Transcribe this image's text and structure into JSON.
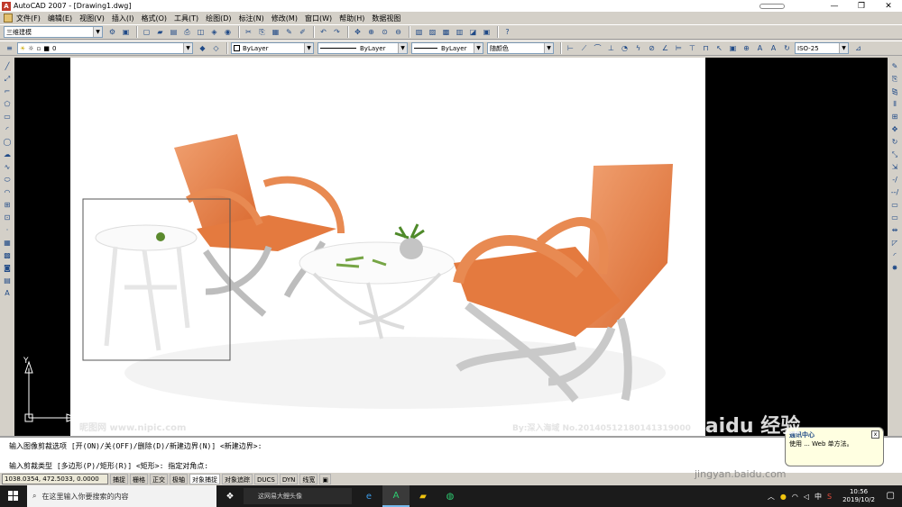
{
  "window": {
    "title": "AutoCAD 2007 - [Drawing1.dwg]",
    "app_icon": "A",
    "minimize": "—",
    "maximize": "❐",
    "close": "✕"
  },
  "menu": [
    "文件(F)",
    "编辑(E)",
    "视图(V)",
    "插入(I)",
    "格式(O)",
    "工具(T)",
    "绘图(D)",
    "标注(N)",
    "修改(M)",
    "窗口(W)",
    "帮助(H)",
    "数据视图"
  ],
  "toolbar1": {
    "workspace": "三维建模"
  },
  "toolbar2": {
    "layer": "0",
    "color": "ByLayer",
    "linetype": "ByLayer",
    "lineweight": "ByLayer",
    "plotstyle": "随颜色",
    "dimstyle": "ISO-25"
  },
  "canvas": {
    "ucs_y": "Y",
    "ucs_x": "X",
    "watermark_left": "昵图网 www.nipic.com",
    "watermark_right": "By:深入海域 No.20140512180141319000"
  },
  "command": {
    "line1": "输入图像剪裁选项 [开(ON)/关(OFF)/删除(D)/新建边界(N)] <新建边界>:",
    "line2": "输入剪裁类型 [多边形(P)/矩形(R)] <矩形>: 指定对角点:"
  },
  "status": {
    "coords": "1038.0354, 472.5033, 0.0000",
    "buttons": [
      "捕捉",
      "栅格",
      "正交",
      "极轴",
      "对象捕捉",
      "对象追踪",
      "DUCS",
      "DYN",
      "线宽"
    ]
  },
  "popup": {
    "title": "通讯中心",
    "text": "使用 ... Web 单方法。",
    "close": "x"
  },
  "overlay": {
    "brand": "Baidu 经验",
    "url": "jingyan.baidu.com"
  },
  "taskbar": {
    "search_placeholder": "在这里输入你要搜索的内容",
    "edge_tab": "这网易大鲤头像",
    "time": "10:56",
    "date": "2019/10/2",
    "ime": "中"
  }
}
